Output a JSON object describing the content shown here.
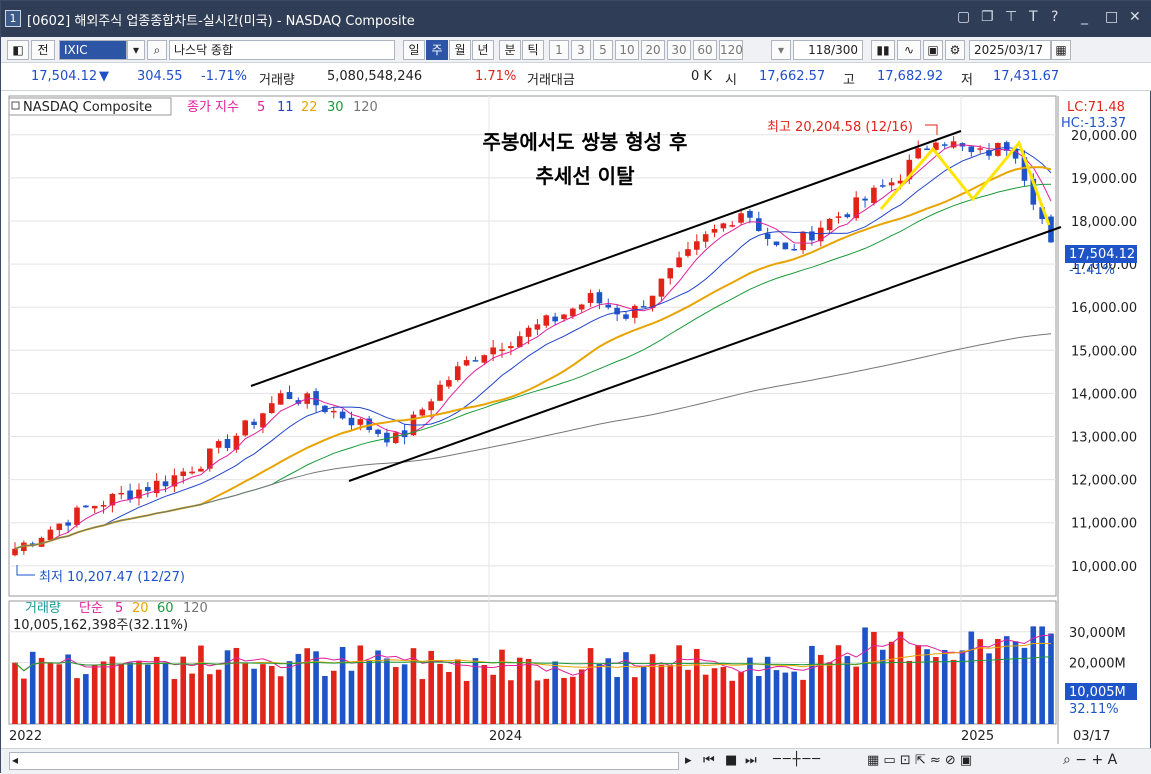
{
  "window": {
    "number": "1",
    "title": "[0602] 해외주식 업종종합차트-실시간(미국) - NASDAQ Composite"
  },
  "toolbar": {
    "prev_label": "전",
    "symbol": "IXIC",
    "symbol_name": "나스닥 종합",
    "periods": [
      "일",
      "주",
      "월",
      "년",
      "분",
      "틱"
    ],
    "selected_period": "주",
    "intervals": [
      "1",
      "3",
      "5",
      "10",
      "20",
      "30",
      "60",
      "120"
    ],
    "count": "118/300",
    "date": "2025/03/17"
  },
  "quote": {
    "price": "17,504.12",
    "change": "304.55",
    "change_pct": "-1.71%",
    "volume_label": "거래량",
    "volume": "5,080,548,246",
    "volume_ratio": "1.71%",
    "turnover_label": "거래대금",
    "turnover": "0 K",
    "open_label": "시",
    "open": "17,662.57",
    "high_label": "고",
    "high": "17,682.92",
    "low_label": "저",
    "low": "17,431.67"
  },
  "legend": {
    "name": "NASDAQ Composite",
    "ma_label": "종가 지수",
    "ma_periods": [
      "5",
      "11",
      "22",
      "30",
      "120"
    ],
    "ma_colors": [
      "#e0209c",
      "#2244cc",
      "#e8a400",
      "#1a9a3a",
      "#777777"
    ]
  },
  "annotations": {
    "lc": "LC:71.48",
    "hc": "HC:-13.37",
    "high_note": "최고 20,204.58 (12/16)",
    "low_note": "최저 10,207.47 (12/27)",
    "comment_line1": "주봉에서도 쌍봉 형성 후",
    "comment_line2": "추세선 이탈",
    "last_price": "17,504.12",
    "last_pct": "-1.41%"
  },
  "volume_panel": {
    "label": "거래량",
    "ma_label": "단순",
    "ma_periods": [
      "5",
      "20",
      "60",
      "120"
    ],
    "ma_colors": [
      "#e0209c",
      "#e8a400",
      "#1a9a3a",
      "#777777"
    ],
    "summary": "10,005,162,398주(32.11%)",
    "last_value": "10,005M",
    "last_pct": "32.11%"
  },
  "x_axis": {
    "labels": [
      "2022",
      "2024",
      "2025"
    ],
    "end_label": "03/17"
  },
  "colors": {
    "up": "#e2231a",
    "down": "#1e54c8",
    "trendline": "#000000",
    "pattern": "#ffe600"
  },
  "chart_data": {
    "type": "candlestick",
    "title": "NASDAQ Composite",
    "period": "weekly",
    "y_ticks": [
      10000,
      11000,
      12000,
      13000,
      14000,
      15000,
      16000,
      17000,
      18000,
      19000,
      20000
    ],
    "y_tick_labels": [
      "10,000.00",
      "11,000.00",
      "12,000.00",
      "13,000.00",
      "14,000.00",
      "15,000.00",
      "16,000.00",
      "17,000.00",
      "18,000.00",
      "19,000.00",
      "20,000.00"
    ],
    "ylim": [
      9300,
      20900
    ],
    "x": [
      "2022-12",
      "2023-01",
      "2023-02",
      "2023-03",
      "2023-04",
      "2023-05",
      "2023-06",
      "2023-07",
      "2023-08",
      "2023-09",
      "2023-10",
      "2023-11",
      "2023-12",
      "2024-01",
      "2024-02",
      "2024-03",
      "2024-04",
      "2024-05",
      "2024-06",
      "2024-07",
      "2024-08",
      "2024-09",
      "2024-10",
      "2024-11",
      "2024-12",
      "2025-01",
      "2025-02",
      "2025-03"
    ],
    "close_path": [
      10400,
      10900,
      11400,
      11700,
      12000,
      12500,
      13200,
      14000,
      13700,
      13300,
      12900,
      14100,
      14900,
      15300,
      15700,
      16200,
      15800,
      16700,
      17600,
      18300,
      17200,
      17900,
      18400,
      19000,
      20000,
      19500,
      19800,
      17500
    ],
    "high": {
      "value": 20204.58,
      "date": "12/16"
    },
    "low": {
      "value": 10207.47,
      "date": "12/27"
    },
    "last": {
      "close": 17504.12,
      "change_pct": -1.41
    },
    "volume_ticks": [
      "30,000M",
      "20,000M"
    ],
    "volume_ylim": [
      0,
      40000
    ]
  }
}
